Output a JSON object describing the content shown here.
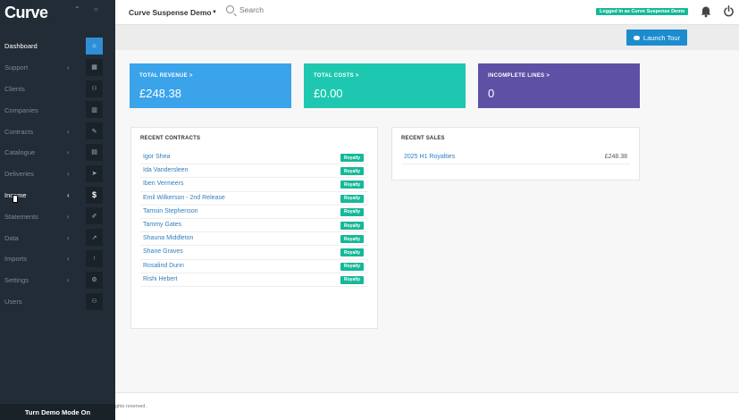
{
  "app": {
    "logo": "Curve",
    "top_icons": [
      "chevron-up",
      "circle"
    ]
  },
  "sidebar": {
    "items": [
      {
        "label": "Dashboard",
        "icon": "home-icon",
        "chevron": false,
        "state": "active"
      },
      {
        "label": "Support",
        "icon": "calendar-icon",
        "chevron": true,
        "state": ""
      },
      {
        "label": "Clients",
        "icon": "users-icon",
        "chevron": false,
        "state": ""
      },
      {
        "label": "Companies",
        "icon": "building-icon",
        "chevron": false,
        "state": ""
      },
      {
        "label": "Contracts",
        "icon": "pencil-icon",
        "chevron": true,
        "state": ""
      },
      {
        "label": "Catalogue",
        "icon": "book-icon",
        "chevron": true,
        "state": ""
      },
      {
        "label": "Deliveries",
        "icon": "send-icon",
        "chevron": true,
        "state": ""
      },
      {
        "label": "Income",
        "icon": "dollar-icon",
        "chevron": true,
        "state": "hover"
      },
      {
        "label": "Statements",
        "icon": "paperclip-icon",
        "chevron": true,
        "state": ""
      },
      {
        "label": "Data",
        "icon": "chart-icon",
        "chevron": true,
        "state": ""
      },
      {
        "label": "Imports",
        "icon": "upload-icon",
        "chevron": true,
        "state": ""
      },
      {
        "label": "Settings",
        "icon": "gear-icon",
        "chevron": true,
        "state": ""
      },
      {
        "label": "Users",
        "icon": "users-icon",
        "chevron": false,
        "state": ""
      }
    ],
    "demo_button": "Turn Demo Mode On"
  },
  "topbar": {
    "company": "Curve Suspense Demo",
    "search_placeholder": "Search",
    "login_badge": "Logged in as Curve Suspense Demo"
  },
  "toolbar": {
    "launch_tour": "Launch Tour"
  },
  "stats": [
    {
      "label": "TOTAL REVENUE >",
      "value": "£248.38",
      "color": "#3aa3ea"
    },
    {
      "label": "TOTAL COSTS >",
      "value": "£0.00",
      "color": "#1ec8b0"
    },
    {
      "label": "INCOMPLETE LINES >",
      "value": "0",
      "color": "#5d50a5"
    }
  ],
  "recent_contracts": {
    "title": "RECENT CONTRACTS",
    "rows": [
      {
        "name": "Igor Shea",
        "badge": "Royalty"
      },
      {
        "name": "Ida Vandersleen",
        "badge": "Royalty"
      },
      {
        "name": "Iben Vermeers",
        "badge": "Royalty"
      },
      {
        "name": "Emil Wilkerson - 2nd Release",
        "badge": "Royalty"
      },
      {
        "name": "Tamsin Stephenson",
        "badge": "Royalty"
      },
      {
        "name": "Tammy Gates",
        "badge": "Royalty"
      },
      {
        "name": "Shauna Middleton",
        "badge": "Royalty"
      },
      {
        "name": "Shane Graves",
        "badge": "Royalty"
      },
      {
        "name": "Rosalind Dunn",
        "badge": "Royalty"
      },
      {
        "name": "Rishi Hebert",
        "badge": "Royalty"
      }
    ]
  },
  "recent_sales": {
    "title": "RECENT SALES",
    "rows": [
      {
        "name": "2025 H1 Royalties",
        "amount": "£248.38"
      }
    ]
  },
  "footer": {
    "text": "ghts reserved."
  }
}
